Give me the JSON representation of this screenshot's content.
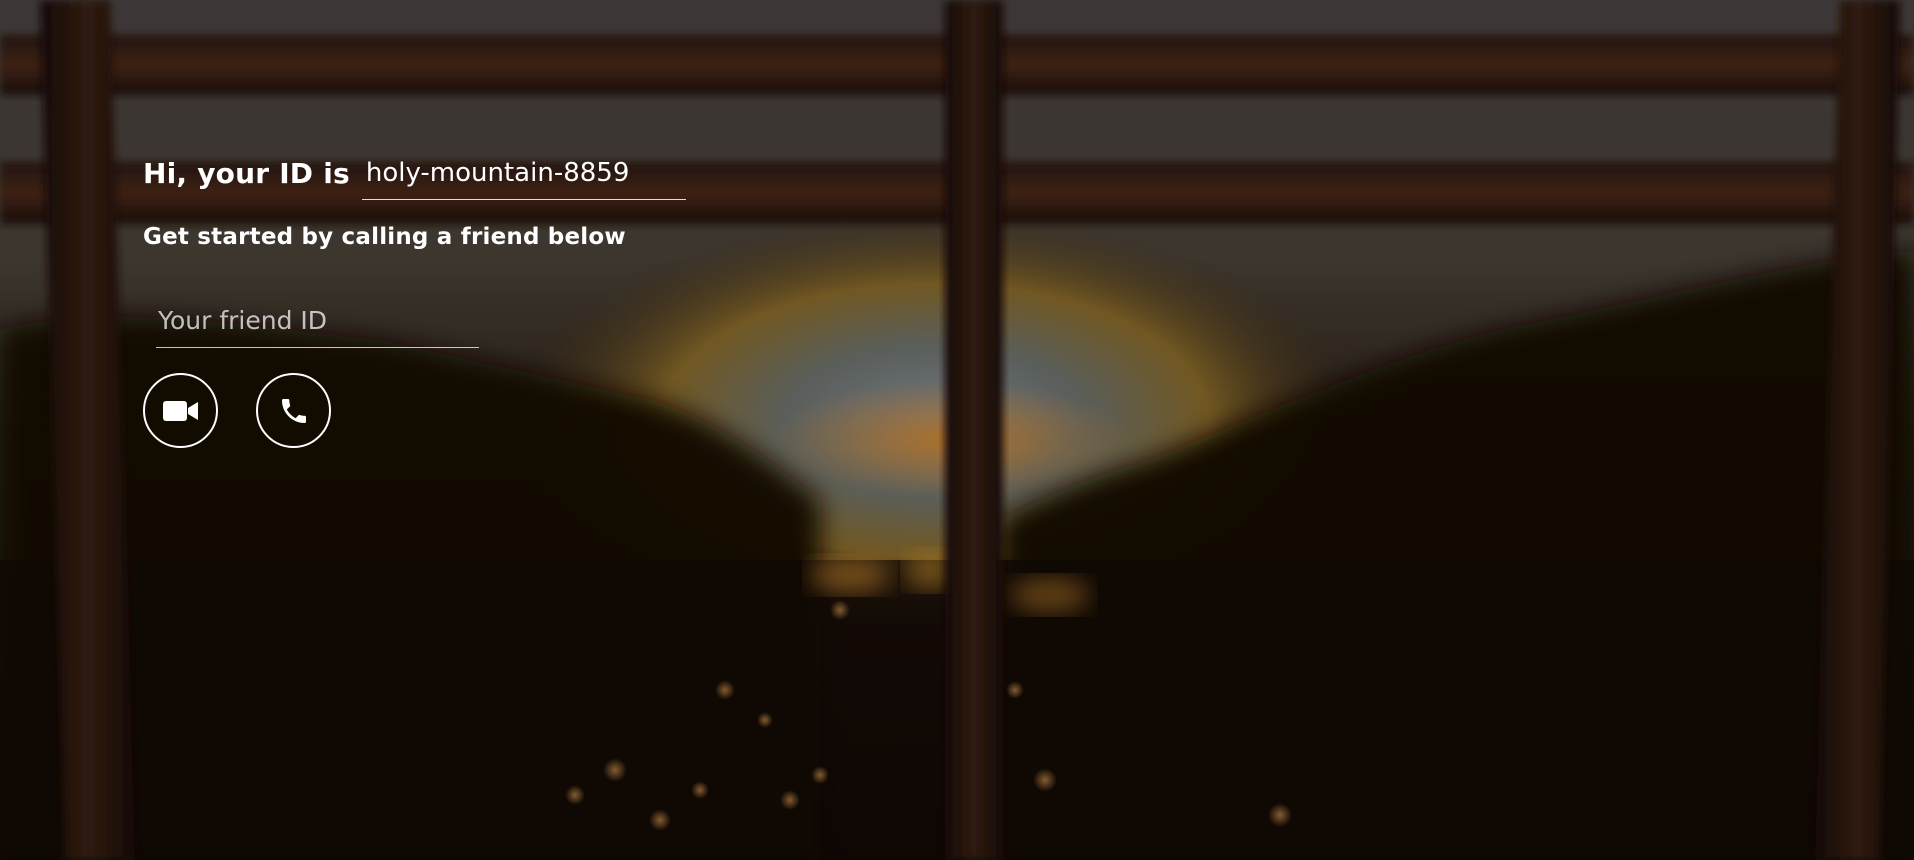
{
  "header": {
    "greeting": "Hi, your ID is",
    "user_id": "holy-mountain-8859",
    "subtitle": "Get started by calling a friend below"
  },
  "friend_input": {
    "placeholder": "Your friend ID",
    "value": ""
  },
  "actions": {
    "video_icon": "video-camera-icon",
    "audio_icon": "phone-icon"
  },
  "colors": {
    "text": "#ffffff",
    "background_dark": "#140a06",
    "sunset_glow": "#d88a2a"
  }
}
